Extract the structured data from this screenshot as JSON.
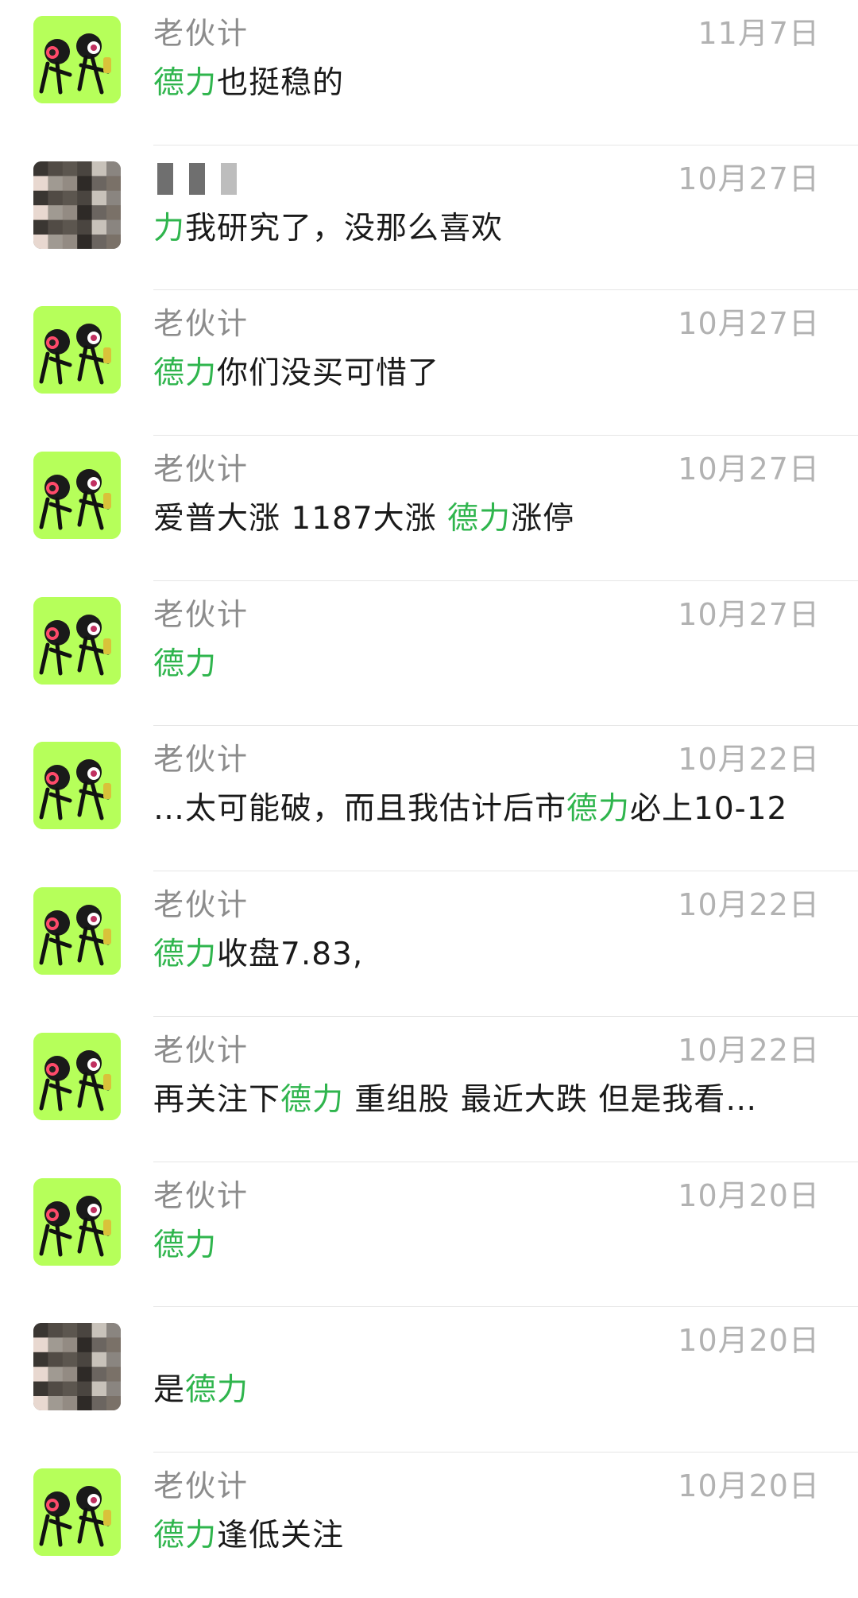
{
  "conversations": [
    {
      "avatar": "green",
      "name": "老伙计",
      "time": "11月7日",
      "parts": [
        {
          "text": "德力",
          "hl": true
        },
        {
          "text": "也挺稳的",
          "hl": false
        }
      ]
    },
    {
      "avatar": "pixel",
      "name": "",
      "name_redacted": true,
      "time": "10月27日",
      "parts": [
        {
          "text": "力",
          "hl": true
        },
        {
          "text": "我研究了，没那么喜欢",
          "hl": false
        }
      ]
    },
    {
      "avatar": "green",
      "name": "老伙计",
      "time": "10月27日",
      "parts": [
        {
          "text": "德力",
          "hl": true
        },
        {
          "text": "你们没买可惜了",
          "hl": false
        }
      ]
    },
    {
      "avatar": "green",
      "name": "老伙计",
      "time": "10月27日",
      "parts": [
        {
          "text": "爱普大涨 1187大涨 ",
          "hl": false
        },
        {
          "text": "德力",
          "hl": true
        },
        {
          "text": "涨停",
          "hl": false
        }
      ]
    },
    {
      "avatar": "green",
      "name": "老伙计",
      "time": "10月27日",
      "parts": [
        {
          "text": "德力",
          "hl": true
        }
      ]
    },
    {
      "avatar": "green",
      "name": "老伙计",
      "time": "10月22日",
      "parts": [
        {
          "text": "…太可能破，而且我估计后市",
          "hl": false
        },
        {
          "text": "德力",
          "hl": true
        },
        {
          "text": "必上10-12",
          "hl": false
        }
      ]
    },
    {
      "avatar": "green",
      "name": "老伙计",
      "time": "10月22日",
      "parts": [
        {
          "text": "德力",
          "hl": true
        },
        {
          "text": "收盘7.83,",
          "hl": false
        }
      ]
    },
    {
      "avatar": "green",
      "name": "老伙计",
      "time": "10月22日",
      "parts": [
        {
          "text": "再关注下",
          "hl": false
        },
        {
          "text": "德力",
          "hl": true
        },
        {
          "text": " 重组股 最近大跌 但是我看…",
          "hl": false
        }
      ]
    },
    {
      "avatar": "green",
      "name": "老伙计",
      "time": "10月20日",
      "parts": [
        {
          "text": "德力",
          "hl": true
        }
      ]
    },
    {
      "avatar": "pixel",
      "name": "",
      "name_redacted": false,
      "time": "10月20日",
      "parts": [
        {
          "text": "是",
          "hl": false
        },
        {
          "text": "德力",
          "hl": true
        }
      ]
    },
    {
      "avatar": "green",
      "name": "老伙计",
      "time": "10月20日",
      "parts": [
        {
          "text": "德力",
          "hl": true
        },
        {
          "text": "逢低关注",
          "hl": false
        }
      ]
    }
  ],
  "colors": {
    "highlight": "#2fb54d",
    "avatar_green": "#b6ff5a"
  }
}
